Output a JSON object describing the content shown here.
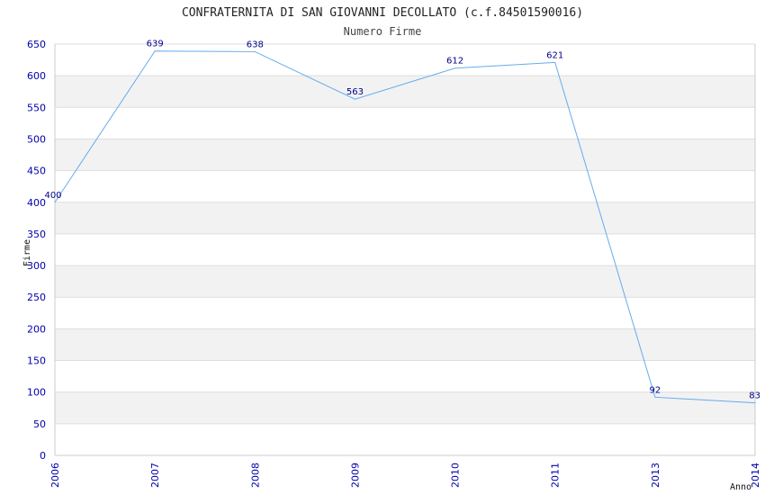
{
  "chart_data": {
    "type": "line",
    "title": "CONFRATERNITA DI SAN GIOVANNI DECOLLATO (c.f.84501590016)",
    "subtitle": "Numero Firme",
    "xlabel": "Anno",
    "ylabel": "Firme",
    "ylim": [
      0,
      650
    ],
    "yticks": [
      0,
      50,
      100,
      150,
      200,
      250,
      300,
      350,
      400,
      450,
      500,
      550,
      600,
      650
    ],
    "categories": [
      "2006",
      "2007",
      "2008",
      "2009",
      "2010",
      "2011",
      "2013",
      "2014"
    ],
    "series": [
      {
        "values": [
          400,
          639,
          638,
          563,
          612,
          621,
          92,
          83
        ]
      }
    ],
    "grid": true,
    "colors": {
      "line": "#66aaee",
      "band": "#f2f2f2",
      "tick": "#0000aa",
      "label": "#000088"
    }
  }
}
